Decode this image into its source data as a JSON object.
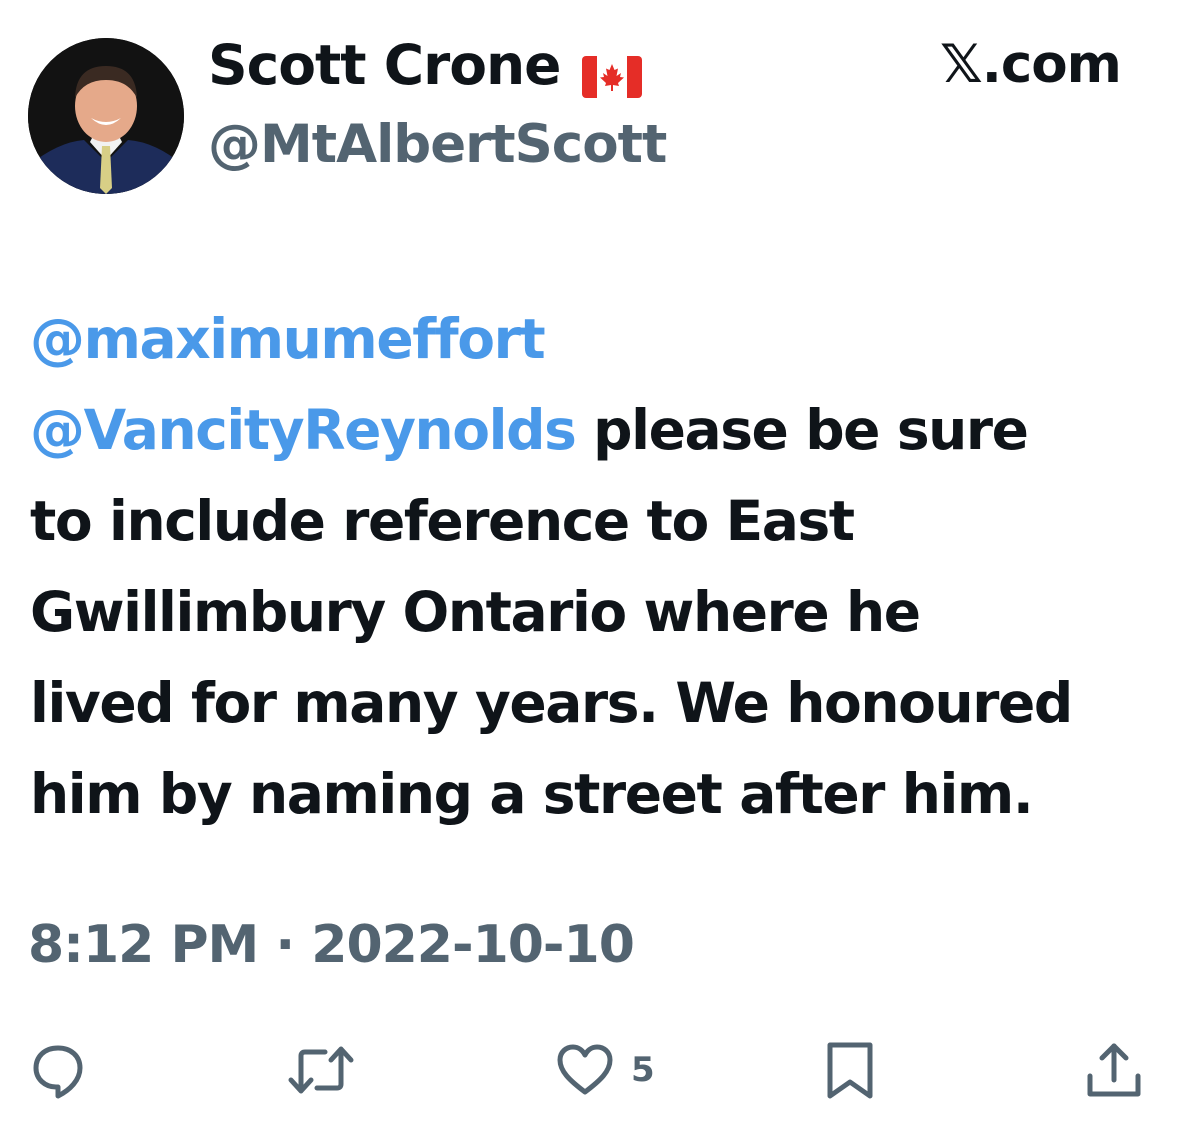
{
  "author": {
    "display_name": "Scott Crone",
    "handle": "@MtAlbertScott",
    "flag_icon": "canada-flag-icon"
  },
  "site_label": "𝕏.com",
  "tweet": {
    "lines": [
      [
        {
          "text": "@maximumeffort",
          "mention": true
        }
      ],
      [
        {
          "text": "@VancityReynolds",
          "mention": true
        },
        {
          "text": " please be sure",
          "mention": false
        }
      ],
      [
        {
          "text": "to include reference to East",
          "mention": false
        }
      ],
      [
        {
          "text": "Gwillimbury Ontario where he",
          "mention": false
        }
      ],
      [
        {
          "text": "lived for many years. We honoured",
          "mention": false
        }
      ],
      [
        {
          "text": "him by naming a street after him.",
          "mention": false
        }
      ]
    ]
  },
  "timestamp": "8:12 PM · 2022-10-10",
  "actions": {
    "reply_icon": "reply-icon",
    "retweet_icon": "retweet-icon",
    "like_icon": "heart-icon",
    "like_count": "5",
    "bookmark_icon": "bookmark-icon",
    "share_icon": "share-icon"
  },
  "colors": {
    "text": "#0f1419",
    "secondary": "#536471",
    "mention": "#4a99e9",
    "background": "#ffffff"
  }
}
